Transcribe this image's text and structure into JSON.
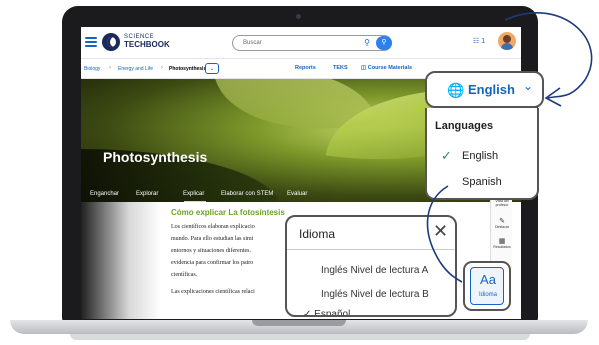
{
  "header": {
    "logo_top": "SCIENCE",
    "logo_bottom": "TECHBOOK",
    "search_placeholder": "Buscar",
    "notification_count": "1"
  },
  "breadcrumb": {
    "items": [
      "Biology",
      "Energy and Life",
      "Photosynthesis"
    ],
    "nav": [
      "Reports",
      "TEKS",
      "Course Materials"
    ]
  },
  "hero": {
    "title": "Photosynthesis",
    "tabs": [
      "Enganchar",
      "Explorar",
      "Explicar",
      "Elaborar con STEM",
      "Evaluar"
    ]
  },
  "content": {
    "section_title": "Cómo explicar La fotosíntesis",
    "lines": [
      "Los científicos elaboran explicacio",
      "mundo. Para ello estudian las simi",
      "entornos y situaciones diferentes.",
      "evidencia para confirmar los patro",
      "científicas.",
      "Las explicaciones científicas relaci"
    ]
  },
  "toolbar": {
    "items": [
      "Vista del profesor",
      "Destacar",
      "Resultados"
    ]
  },
  "language_menu": {
    "selected": "English",
    "heading": "Languages",
    "options": [
      "English",
      "Spanish"
    ],
    "accent": "#1565c0"
  },
  "idioma_panel": {
    "title": "Idioma",
    "options": [
      "Inglés Nivel de lectura A",
      "Inglés Nivel de lectura B",
      "Español"
    ],
    "button_text": "Aa",
    "button_label": "Idioma"
  }
}
